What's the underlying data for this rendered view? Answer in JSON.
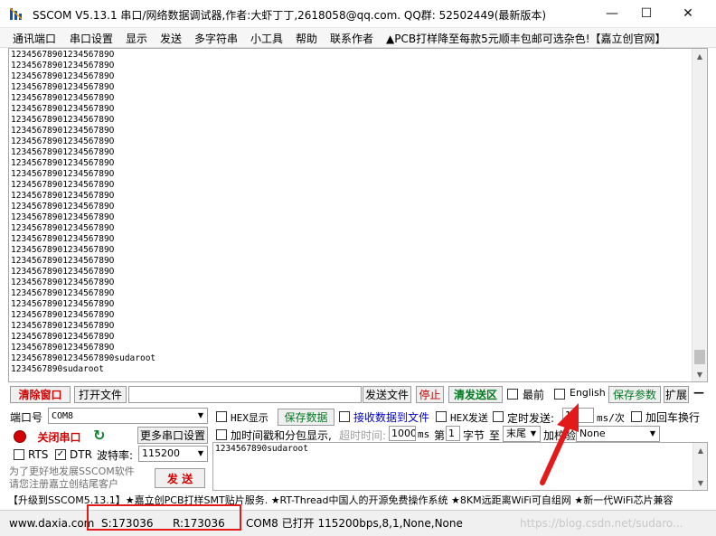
{
  "window": {
    "title": "SSCOM V5.13.1 串口/网络数据调试器,作者:大虾丁丁,2618058@qq.com. QQ群: 52502449(最新版本)",
    "minimize_glyph": "—",
    "maximize_glyph": "☐",
    "close_glyph": "✕"
  },
  "menu": [
    "通讯端口",
    "串口设置",
    "显示",
    "发送",
    "多字符串",
    "小工具",
    "帮助",
    "联系作者",
    "▲PCB打样降至每款5元顺丰包邮可选杂色!【嘉立创官网】"
  ],
  "receive": {
    "lines": [
      "1234567890123456789O",
      "1234567890123456789O",
      "1234567890123456789O",
      "1234567890123456789O",
      "1234567890123456789O",
      "1234567890123456789O",
      "1234567890123456789O",
      "1234567890123456789O",
      "1234567890123456789O",
      "1234567890123456789O",
      "1234567890123456789O",
      "1234567890123456789O",
      "1234567890123456789O",
      "1234567890123456789O",
      "1234567890123456789O",
      "1234567890123456789O",
      "1234567890123456789O",
      "1234567890123456789O",
      "1234567890123456789O",
      "1234567890123456789O",
      "1234567890123456789O",
      "1234567890123456789O",
      "1234567890123456789O",
      "1234567890123456789O",
      "1234567890123456789O",
      "1234567890123456789O",
      "1234567890123456789O",
      "1234567890123456789O",
      "12345678901234567890sudaroot",
      "1234567890sudaroot"
    ]
  },
  "toolbar": {
    "clear_window": "清除窗口",
    "open_file": "打开文件",
    "send_file": "发送文件",
    "stop": "停止",
    "clear_send": "清发送区",
    "topmost": "最前",
    "english": "English",
    "save_params": "保存参数",
    "expand": "扩展",
    "collapse": "—"
  },
  "port": {
    "port_label": "端口号",
    "port_value": "COM8",
    "more_settings": "更多串口设置",
    "close_port": "关闭串口",
    "rts": "RTS",
    "dtr": "DTR",
    "baud_label": "波特率:",
    "baud_value": "115200",
    "promo": "为了更好地发展SSCOM软件\n请您注册嘉立创结尾客户",
    "send": "发 送"
  },
  "options": {
    "hex_display": "HEX显示",
    "save_data": "保存数据",
    "recv_to_file": "接收数据到文件",
    "hex_send": "HEX发送",
    "timed_send": "定时发送:",
    "interval_value": "1",
    "interval_unit": "ms/次",
    "add_crlf": "加回车换行",
    "timestamp": "加时间戳和分包显示,",
    "timeout_label": "超时时间:",
    "timeout_value": "1000",
    "timeout_unit": "ms",
    "nth_label": "第",
    "nth_value": "1",
    "byte_label": "字节",
    "to_label": "至",
    "to_value": "末尾",
    "checksum_label": "加校验",
    "checksum_value": "None"
  },
  "send_area": {
    "text": "1234567890sudaroot"
  },
  "marquee": "【升级到SSCOM5.13.1】★嘉立创PCB打样SMT贴片服务. ★RT-Thread中国人的开源免费操作系统 ★8KM远距离WiFi可自组网 ★新一代WiFi芯片兼容",
  "status": {
    "website": "www.daxia.com",
    "sent": "S:173036",
    "received": "R:173036",
    "port_state": "COM8 已打开  115200bps,8,1,None,None",
    "watermark": "https://blog.csdn.net/sudaro..."
  },
  "colors": {
    "accent_red": "#d40000",
    "accent_green": "#007a20",
    "accent_blue": "#0000c8",
    "annotation_red": "#e21a1a"
  }
}
